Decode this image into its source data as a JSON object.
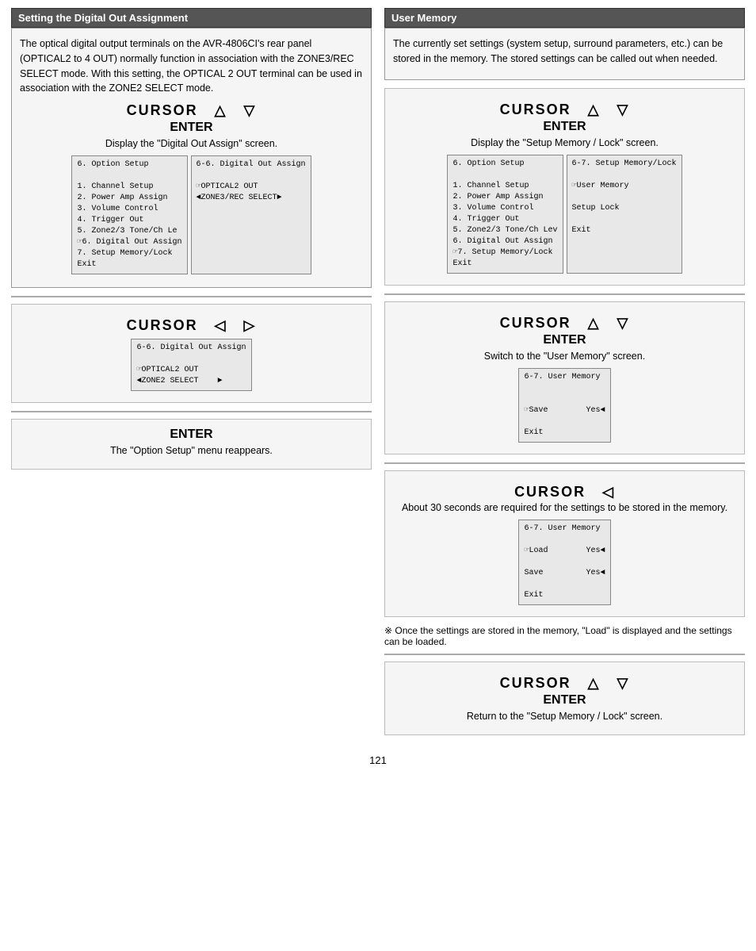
{
  "page": {
    "number": "121"
  },
  "left": {
    "header": "Setting the Digital Out Assignment",
    "intro": "The optical digital output terminals on the AVR-4806CI's rear panel (OPTICAL2 to 4 OUT) normally function in association with the ZONE3/REC SELECT mode. With this setting, the OPTICAL 2 OUT terminal can be used in association with the ZONE2 SELECT mode.",
    "section1": {
      "cursor_label": "CURSOR",
      "cursor_symbols": "△    ▽",
      "enter_label": "ENTER",
      "bullet": "Display the \"Digital Out Assign\" screen.",
      "screen_left": "6. Option Setup\n\n1. Channel Setup\n2. Power Amp Assign\n3. Volume Control\n4. Trigger Out\n5. Zone2/3 Tone/Ch Le\n☞6. Digital Out Assign\n7. Setup Memory/Lock\nExit",
      "screen_right": "6-6. Digital Out Assign\n\n☞OPTICAL2 OUT\n◄ZONE3/REC SELECT►"
    },
    "divider1": true,
    "section2": {
      "cursor_label": "CURSOR",
      "cursor_symbols": "◁    ▷",
      "screen": "6-6. Digital Out Assign\n\n☞OPTICAL2 OUT\n◄ZONE2 SELECT    ►",
      "note": ""
    },
    "divider2": true,
    "section3": {
      "enter_label": "ENTER",
      "bullet": "The \"Option Setup\" menu reappears."
    }
  },
  "right": {
    "header": "User Memory",
    "intro": "The currently set settings (system setup, surround parameters, etc.) can be stored in the memory. The stored settings can be called out when needed.",
    "section1": {
      "cursor_label": "CURSOR",
      "cursor_symbols": "△    ▽",
      "enter_label": "ENTER",
      "bullet": "Display the \"Setup Memory / Lock\" screen.",
      "screen_left": "6. Option Setup\n\n1. Channel Setup\n2. Power Amp Assign\n3. Volume Control\n4. Trigger Out\n5. Zone2/3 Tone/Ch Lev\n6. Digital Out Assign\n☞7. Setup Memory/Lock\nExit",
      "screen_right": "6-7. Setup Memory/Lock\n\n☞User Memory\n\nSetup Lock\n\nExit"
    },
    "divider1": true,
    "section2": {
      "cursor_label": "CURSOR",
      "cursor_symbols": "△    ▽",
      "enter_label": "ENTER",
      "bullet": "Switch to the \"User Memory\" screen.",
      "screen": "6-7. User Memory\n\n\n☞Save        Yes◄\n\nExit"
    },
    "divider2": true,
    "section3": {
      "cursor_label": "CURSOR",
      "cursor_symbols": "◁",
      "bullet": "About 30 seconds are required for the settings to be stored in the memory.",
      "screen": "6-7. User Memory\n\n☞Load        Yes◄\n\nSave         Yes◄\n\nExit"
    },
    "note": "※  Once the settings are stored in the memory, \"Load\" is displayed and the settings can be loaded.",
    "divider3": true,
    "section4": {
      "cursor_label": "CURSOR",
      "cursor_symbols": "△    ▽",
      "enter_label": "ENTER",
      "bullet": "Return to the \"Setup Memory / Lock\" screen."
    }
  }
}
